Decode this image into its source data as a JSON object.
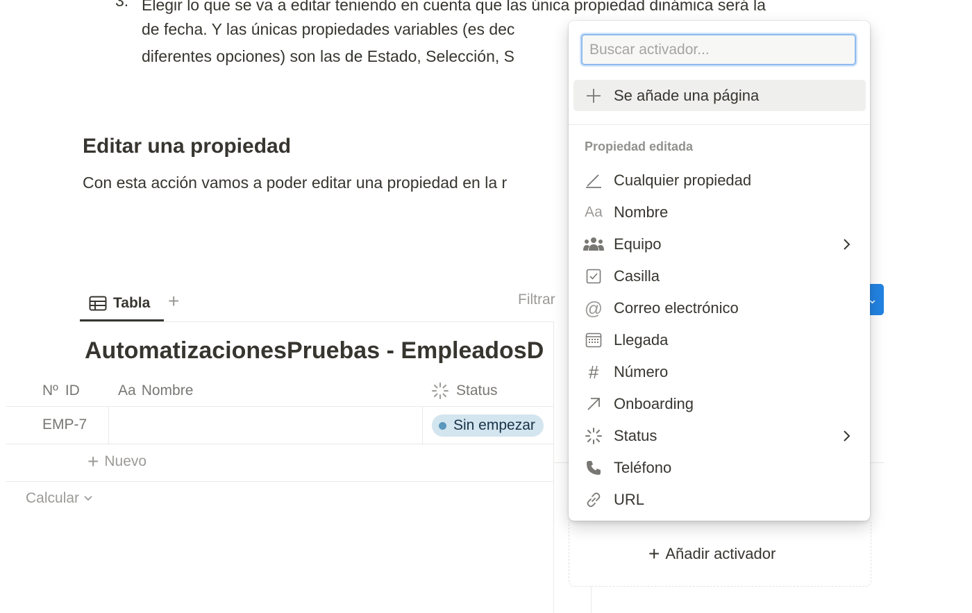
{
  "document": {
    "list_number": "3.",
    "list_lines": [
      "Elegir lo que se va a editar teniendo en cuenta que las única propiedad dinámica será la",
      "de fecha. Y las únicas propiedades variables (es dec",
      "diferentes opciones) son las de Estado, Selección, S"
    ],
    "heading": "Editar una propiedad",
    "paragraph": "Con esta acción vamos a poder editar una propiedad en la r"
  },
  "database": {
    "tab_label": "Tabla",
    "filter_label": "Filtrar",
    "title": "AutomatizacionesPruebas - EmpleadosD",
    "columns": [
      {
        "icon_text": "Nº",
        "label": "ID"
      },
      {
        "icon_text": "Aa",
        "label": "Nombre"
      },
      {
        "icon_text": "",
        "label": "Status"
      }
    ],
    "rows": [
      {
        "id": "EMP-7",
        "nombre": "",
        "status": "Sin empezar"
      }
    ],
    "new_row_label": "Nuevo",
    "calc_label": "Calcular"
  },
  "panel": {
    "add_trigger_label": "Añadir activador"
  },
  "dropdown": {
    "search_placeholder": "Buscar activador...",
    "first_item": "Se añade una página",
    "section_label": "Propiedad editada",
    "items": [
      {
        "label": "Cualquier propiedad",
        "icon": "pencil-icon"
      },
      {
        "label": "Nombre",
        "icon": "text-aa-icon",
        "icon_text": "Aa"
      },
      {
        "label": "Equipo",
        "icon": "people-icon",
        "has_submenu": true
      },
      {
        "label": "Casilla",
        "icon": "checkbox-icon"
      },
      {
        "label": "Correo electrónico",
        "icon": "at-icon",
        "icon_text": "@"
      },
      {
        "label": "Llegada",
        "icon": "calendar-icon"
      },
      {
        "label": "Número",
        "icon": "hash-icon",
        "icon_text": "#"
      },
      {
        "label": "Onboarding",
        "icon": "arrow-up-right-icon"
      },
      {
        "label": "Status",
        "icon": "status-spinner-icon",
        "has_submenu": true
      },
      {
        "label": "Teléfono",
        "icon": "phone-icon"
      },
      {
        "label": "URL",
        "icon": "link-icon"
      }
    ]
  },
  "colors": {
    "accent_blue": "#2383e2",
    "status_pill_bg": "#d3e5ef",
    "status_dot": "#5b97bd",
    "text": "#37352f",
    "muted": "#787774"
  }
}
